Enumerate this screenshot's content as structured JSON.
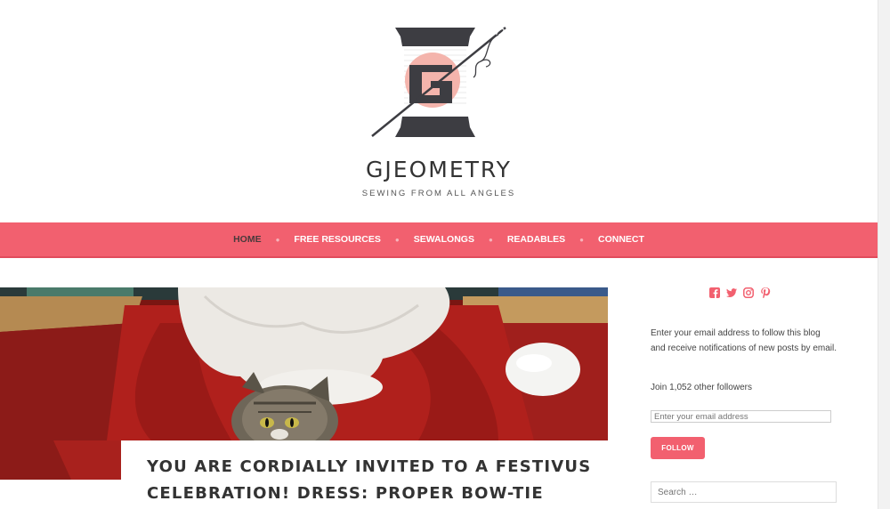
{
  "site": {
    "title": "GJEOMETRY",
    "tagline": "SEWING FROM ALL ANGLES"
  },
  "colors": {
    "accent": "#f2606f",
    "logo_pink": "#f4b4ac",
    "logo_dark": "#3d3d42"
  },
  "nav": {
    "items": [
      {
        "label": "HOME",
        "active": true
      },
      {
        "label": "FREE RESOURCES"
      },
      {
        "label": "SEWALONGS"
      },
      {
        "label": "READABLES"
      },
      {
        "label": "CONNECT"
      }
    ]
  },
  "post": {
    "title_line1": "YOU ARE CORDIALLY INVITED TO A FESTIVUS",
    "title_line2": "CELEBRATION! DRESS: PROPER BOW-TIE"
  },
  "sidebar": {
    "social_icons": [
      "facebook-icon",
      "twitter-icon",
      "instagram-icon",
      "pinterest-icon"
    ],
    "follow_text": "Enter your email address to follow this blog and receive notifications of new posts by email.",
    "followers_text": "Join 1,052 other followers",
    "email_placeholder": "Enter your email address",
    "follow_button": "FOLLOW",
    "search_placeholder": "Search …"
  }
}
